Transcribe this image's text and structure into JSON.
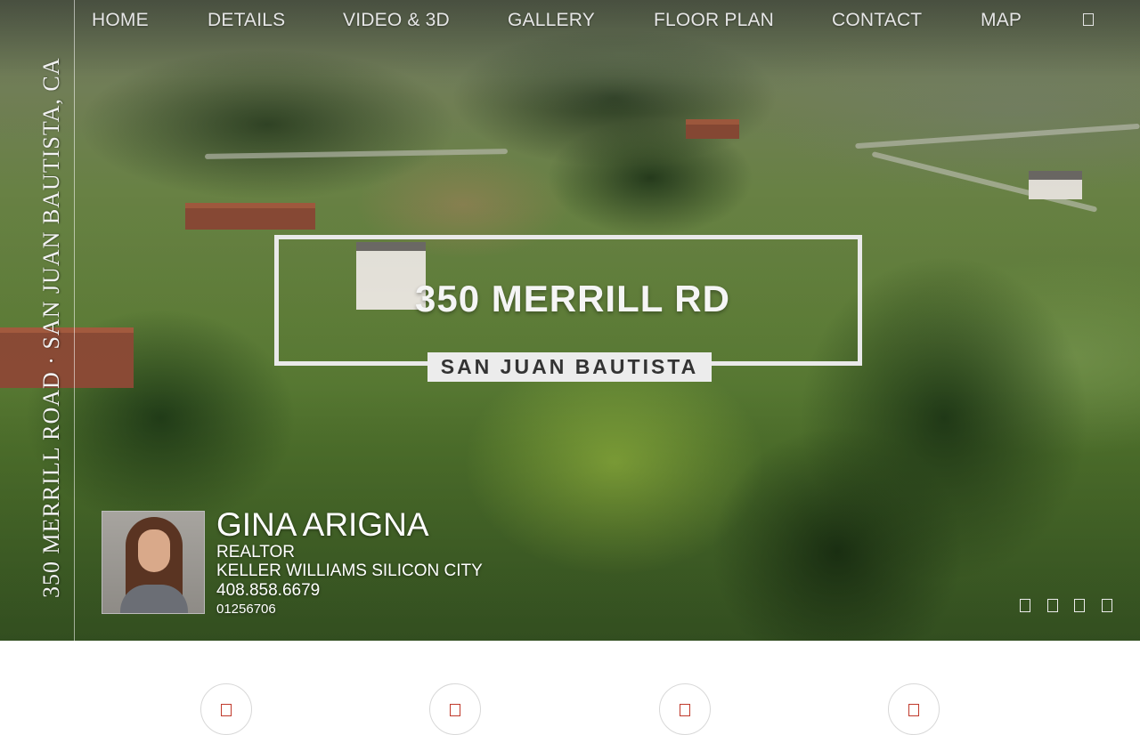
{
  "nav": {
    "items": [
      "HOME",
      "DETAILS",
      "VIDEO & 3D",
      "GALLERY",
      "FLOOR PLAN",
      "CONTACT",
      "MAP"
    ],
    "menu_icon": "menu-icon"
  },
  "side": {
    "title": "350 MERRILL ROAD · SAN JUAN BAUTISTA, CA"
  },
  "hero": {
    "address": "350 MERRILL RD",
    "city": "SAN JUAN BAUTISTA"
  },
  "agent": {
    "name": "GINA ARIGNA",
    "title": "REALTOR",
    "company": "KELLER WILLIAMS SILICON CITY",
    "phone": "408.858.6679",
    "license": "01256706"
  },
  "slider": {
    "dot_count": 4
  },
  "bottom_icons": [
    "feature-icon-1",
    "feature-icon-2",
    "feature-icon-3",
    "feature-icon-4"
  ],
  "colors": {
    "accent": "#c0392b",
    "nav_text": "#e6e6e6"
  }
}
